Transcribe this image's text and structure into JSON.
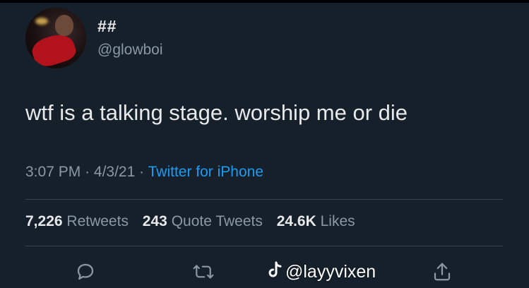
{
  "tweet": {
    "display_name": "##",
    "handle": "@glowboi",
    "text": "wtf is a talking stage. worship me or die",
    "time": "3:07 PM",
    "date": "4/3/21",
    "separator": "·",
    "source": "Twitter for iPhone"
  },
  "stats": {
    "retweets_count": "7,226",
    "retweets_label": "Retweets",
    "quote_count": "243",
    "quote_label": "Quote Tweets",
    "likes_count": "24.6K",
    "likes_label": "Likes"
  },
  "actions": {
    "reply_icon": "reply-icon",
    "retweet_icon": "retweet-icon",
    "share_icon": "share-icon"
  },
  "watermark": {
    "logo": "tiktok-logo",
    "user": "@layyvixen"
  },
  "colors": {
    "background": "#15202b",
    "text": "#e7e9ea",
    "secondary": "#8b98a5",
    "accent": "#1d9bf0",
    "divider": "#38444d"
  }
}
